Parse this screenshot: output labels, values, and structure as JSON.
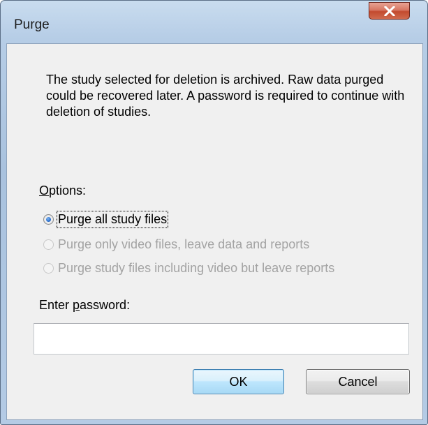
{
  "window": {
    "title": "Purge"
  },
  "message": "The study selected for deletion is archived. Raw data purged could be recovered later. A password is required to continue with deletion of studies.",
  "options": {
    "label_accel": "O",
    "label_rest": "ptions:",
    "items": [
      {
        "label": "Purge all study files",
        "checked": true,
        "enabled": true
      },
      {
        "label": "Purge only video files, leave data and reports",
        "checked": false,
        "enabled": false
      },
      {
        "label": "Purge study files including video but leave reports",
        "checked": false,
        "enabled": false
      }
    ]
  },
  "password": {
    "label_pre": "Enter ",
    "label_accel": "p",
    "label_post": "assword:",
    "value": ""
  },
  "buttons": {
    "ok": "OK",
    "cancel": "Cancel"
  },
  "colors": {
    "title_bar": "#b6cde6",
    "close_button": "#c34a2f",
    "client_bg": "#f0f0f0",
    "selected_radio": "#2b6fcf",
    "default_button_border": "#3c7fb1"
  }
}
